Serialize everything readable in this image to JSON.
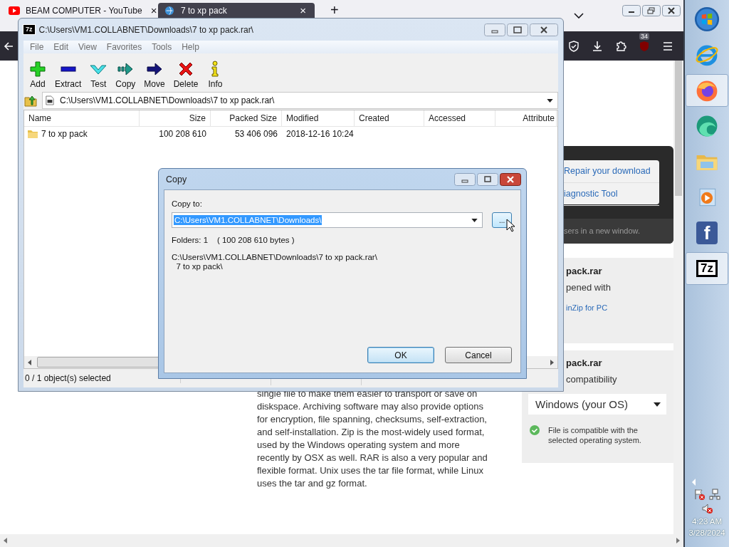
{
  "browser": {
    "tabs": [
      {
        "title": "BEAM COMPUTER - YouTube",
        "selected": false,
        "close": "×"
      },
      {
        "title": "7 to xp pack",
        "selected": true,
        "close": "×"
      }
    ],
    "new_tab": "+",
    "addon_badge": "34"
  },
  "webpage": {
    "help_box": {
      "links": [
        "Repair your download",
        "iagnostic Tool"
      ],
      "note": "sers in a new window."
    },
    "open_card": {
      "title": "pack.rar",
      "text": "pened with",
      "link": "inZip for PC"
    },
    "compat_card": {
      "title": "pack.rar",
      "text": "compatibility",
      "os_select": "Windows (your OS)",
      "status": "File is compatible with the selected operating system.",
      "compatible": true
    },
    "article": "single file to make them easier to transport or save on diskspace. Archiving software may also provide options for encryption, file spanning, checksums, self-extraction, and self-installation. Zip is the most-widely used format, used by the Windows operating system and more recently by OSX as well. RAR is also a very popular and flexible format. Unix uses the tar file format, while Linux uses the tar and gz format."
  },
  "archiver": {
    "logo": "7z",
    "title": "C:\\Users\\VM1.COLLABNET\\Downloads\\7 to xp pack.rar\\",
    "menu": [
      "File",
      "Edit",
      "View",
      "Favorites",
      "Tools",
      "Help"
    ],
    "toolbar": [
      {
        "label": "Add",
        "kind": "add"
      },
      {
        "label": "Extract",
        "kind": "extract"
      },
      {
        "label": "Test",
        "kind": "test"
      },
      {
        "label": "Copy",
        "kind": "copy"
      },
      {
        "label": "Move",
        "kind": "move"
      },
      {
        "label": "Delete",
        "kind": "delete"
      },
      {
        "label": "Info",
        "kind": "info"
      }
    ],
    "address": "C:\\Users\\VM1.COLLABNET\\Downloads\\7 to xp pack.rar\\",
    "columns": [
      "Name",
      "Size",
      "Packed Size",
      "Modified",
      "Created",
      "Accessed",
      "Attribute"
    ],
    "rows": [
      {
        "name": "7 to xp pack",
        "size": "100 208 610",
        "packed_size": "53 406 096",
        "modified": "2018-12-16 10:24",
        "selected": false
      }
    ],
    "status": "0 / 1 object(s) selected"
  },
  "copy_dialog": {
    "title": "Copy",
    "label": "Copy to:",
    "value": "C:\\Users\\VM1.COLLABNET\\Downloads\\",
    "value_selected": true,
    "browse": "...",
    "browse_hovered": true,
    "summary": "Folders: 1    ( 100 208 610 bytes )",
    "source_lines": [
      "C:\\Users\\VM1.COLLABNET\\Downloads\\7 to xp pack.rar\\",
      "  7 to xp pack\\"
    ],
    "buttons": [
      {
        "label": "OK",
        "default": true
      },
      {
        "label": "Cancel",
        "default": false
      }
    ]
  },
  "taskbar": {
    "apps": [
      {
        "kind": "start",
        "active": false
      },
      {
        "kind": "ie",
        "active": false
      },
      {
        "kind": "firefox",
        "active": true
      },
      {
        "kind": "edge",
        "active": false
      },
      {
        "kind": "explorer",
        "active": false
      },
      {
        "kind": "media",
        "active": false
      },
      {
        "kind": "facebook",
        "active": false,
        "letter": "f"
      },
      {
        "kind": "archiver",
        "active": true,
        "letter": "7z"
      }
    ],
    "time": "4:23 AM",
    "date": "3/28/2024"
  }
}
